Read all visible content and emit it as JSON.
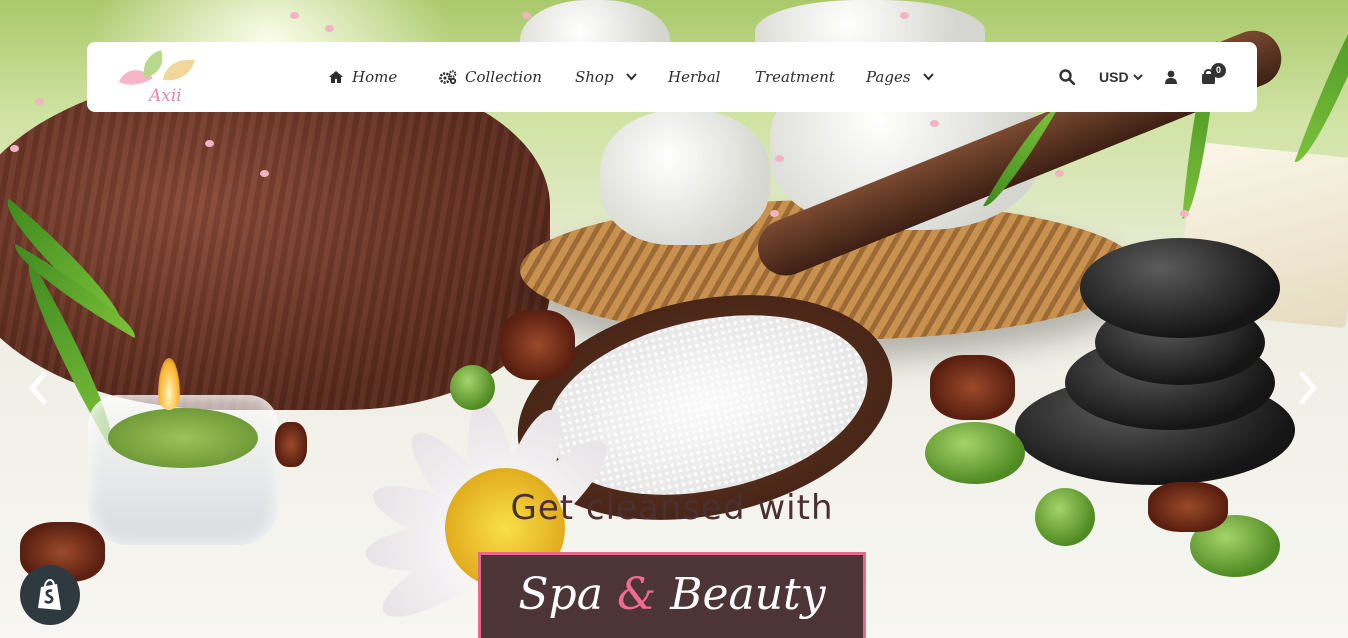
{
  "brand": {
    "logo_text": "Axii"
  },
  "nav": {
    "items": [
      {
        "label": "Home",
        "icon": "home-icon"
      },
      {
        "label": "Collection",
        "icon": "gears-icon"
      },
      {
        "label": "Shop",
        "has_dropdown": true
      },
      {
        "label": "Herbal"
      },
      {
        "label": "Treatment"
      },
      {
        "label": "Pages",
        "has_dropdown": true
      }
    ]
  },
  "tools": {
    "search_icon": "search-icon",
    "currency": "USD",
    "account_icon": "user-icon",
    "cart_icon": "shopping-bag-icon",
    "cart_count": "0"
  },
  "slider": {
    "prev_icon": "chevron-left-icon",
    "next_icon": "chevron-right-icon",
    "caption_line1": "Get cleansed with",
    "caption_line2_a": "Spa",
    "caption_line2_amp": "&",
    "caption_line2_b": "Beauty"
  },
  "badge": {
    "icon": "shopify-icon"
  },
  "colors": {
    "accent_pink": "#e56a8d",
    "caption_bg": "#4d3436",
    "nav_text": "#2e2e2e"
  }
}
